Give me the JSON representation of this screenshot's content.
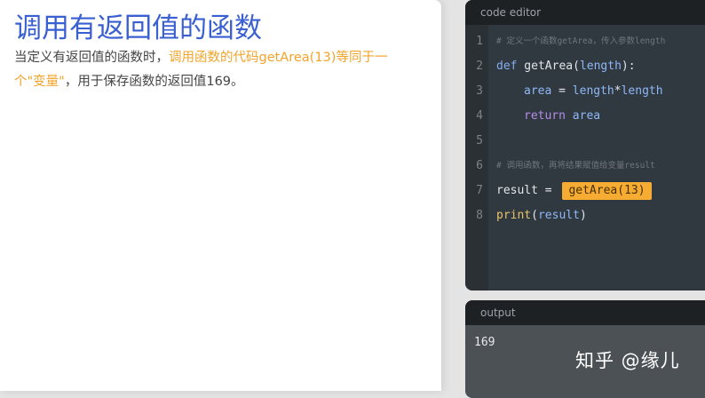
{
  "lesson": {
    "title": "调用有返回值的函数",
    "text_before": "当定义有返回值的函数时，",
    "text_highlight": "调用函数的代码getArea(13)等同于一个\"变量\"",
    "text_after": "，用于保存函数的返回值169。"
  },
  "editor": {
    "header": "code editor",
    "lines": [
      {
        "num": "1",
        "comment": "# 定义一个函数getArea，传入参数length"
      },
      {
        "num": "2",
        "kw": "def",
        "fn": " getArea(",
        "param": "length",
        "rest": "):"
      },
      {
        "num": "3",
        "var1": "area",
        "op": " = ",
        "var2": "length",
        "op2": "*",
        "var3": "length"
      },
      {
        "num": "4",
        "kw": "return",
        "var": " area"
      },
      {
        "num": "5"
      },
      {
        "num": "6",
        "comment": "# 调用函数，再将结果赋值给变量result"
      },
      {
        "num": "7",
        "var": "result",
        "op": " = ",
        "highlight": "getArea(13)"
      },
      {
        "num": "8",
        "pr": "print",
        "po": "(",
        "var": "result",
        "pc": ")"
      }
    ]
  },
  "output": {
    "header": "output",
    "text": "169"
  },
  "watermark": "知乎 @缘儿"
}
